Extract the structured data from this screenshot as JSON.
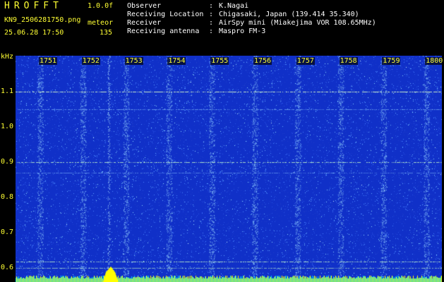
{
  "header": {
    "app_title": "HROFFT",
    "version": "1.0.0f",
    "filename": "KN9_2506281750.png",
    "mode": "meteor",
    "datetime": "25.06.28 17:50",
    "count": "135"
  },
  "info": [
    {
      "key": "Observer",
      "value": "K.Nagai"
    },
    {
      "key": "Receiving Location",
      "value": "Chigasaki, Japan (139.414 35.340)"
    },
    {
      "key": "Receiver",
      "value": "AirSpy mini (Miakejima VOR 108.65MHz)"
    },
    {
      "key": "Receiving antenna",
      "value": "Maspro FM-3"
    }
  ],
  "axis": {
    "unit": "kHz",
    "y_ticks": [
      "1.1",
      "1.0",
      "0.9",
      "0.8",
      "0.7",
      "0.6"
    ],
    "time_ticks": [
      "1751",
      "1752",
      "1753",
      "1754",
      "1755",
      "1756",
      "1757",
      "1758",
      "1759",
      "1800"
    ]
  },
  "colors": {
    "background": "#000000",
    "label": "#ffff33",
    "plot": "#1030c8"
  }
}
